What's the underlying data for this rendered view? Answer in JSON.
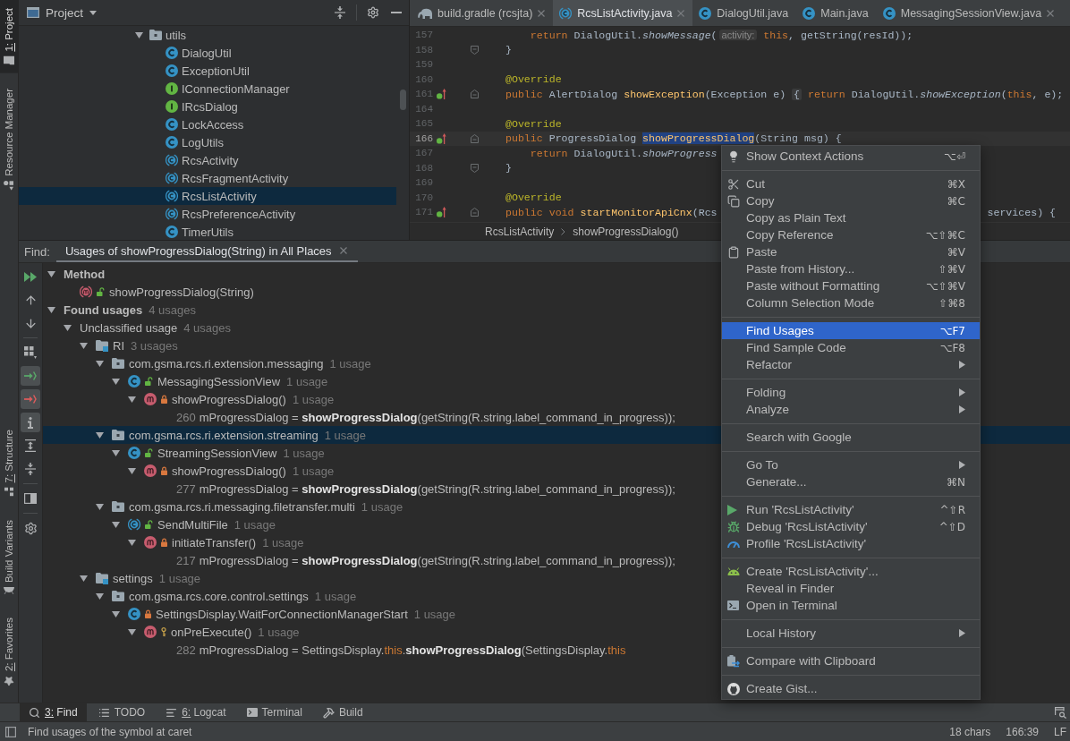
{
  "left_strip": {
    "top": [
      {
        "label": "1: Project",
        "kind": "project",
        "selected": true,
        "mnemonic": true
      },
      {
        "label": "Resource Manager",
        "kind": "resources",
        "selected": false,
        "mnemonic": false
      }
    ],
    "bottom": [
      {
        "label": "7: Structure",
        "kind": "structure",
        "selected": false,
        "mnemonic": true
      },
      {
        "label": "Build Variants",
        "kind": "variants",
        "selected": false,
        "mnemonic": false
      },
      {
        "label": "2: Favorites",
        "kind": "favorites",
        "selected": false,
        "mnemonic": true
      }
    ]
  },
  "project_panel": {
    "title": "Project",
    "tree": {
      "label": "utils",
      "kind": "package",
      "expanded": true,
      "selected": false,
      "children": [
        {
          "label": "DialogUtil",
          "kind": "class",
          "selected": false
        },
        {
          "label": "ExceptionUtil",
          "kind": "class",
          "selected": false
        },
        {
          "label": "IConnectionManager",
          "kind": "interface",
          "selected": false
        },
        {
          "label": "IRcsDialog",
          "kind": "interface",
          "selected": false
        },
        {
          "label": "LockAccess",
          "kind": "class",
          "selected": false
        },
        {
          "label": "LogUtils",
          "kind": "class",
          "selected": false
        },
        {
          "label": "RcsActivity",
          "kind": "abstract_class",
          "selected": false
        },
        {
          "label": "RcsFragmentActivity",
          "kind": "abstract_class",
          "selected": false
        },
        {
          "label": "RcsListActivity",
          "kind": "abstract_class",
          "selected": true
        },
        {
          "label": "RcsPreferenceActivity",
          "kind": "abstract_class",
          "selected": false
        },
        {
          "label": "TimerUtils",
          "kind": "class",
          "selected": false
        }
      ]
    }
  },
  "editor": {
    "tabs": [
      {
        "label": "build.gradle (rcsjta)",
        "kind": "gradle",
        "selected": false,
        "closable": true
      },
      {
        "label": "RcsListActivity.java",
        "kind": "abstract_class",
        "selected": true,
        "closable": true
      },
      {
        "label": "DialogUtil.java",
        "kind": "class",
        "selected": false,
        "closable": false
      },
      {
        "label": "Main.java",
        "kind": "class",
        "selected": false,
        "closable": false
      },
      {
        "label": "MessagingSessionView.java",
        "kind": "class",
        "selected": false,
        "closable": true
      }
    ],
    "lines": [
      {
        "number": "157",
        "current": false,
        "override": false,
        "fold_start": false,
        "fold_end": false,
        "indented": true,
        "tokens": [
          {
            "text": "return",
            "kind": "keyword"
          },
          {
            "text": " DialogUtil.",
            "kind": "plain"
          },
          {
            "text": "showMessage",
            "kind": "static_call"
          },
          {
            "text": "(",
            "kind": "plain"
          },
          {
            "text": "activity:",
            "kind": "hint"
          },
          {
            "text": " this",
            "kind": "keyword"
          },
          {
            "text": ", getString(resId));",
            "kind": "plain"
          }
        ]
      },
      {
        "number": "158",
        "current": false,
        "override": false,
        "fold_start": false,
        "fold_end": true,
        "indented": false,
        "tokens": [
          {
            "text": "}",
            "kind": "plain"
          }
        ]
      },
      {
        "number": "159",
        "current": false,
        "override": false,
        "fold_start": false,
        "fold_end": false
      },
      {
        "number": "160",
        "current": false,
        "override": false,
        "fold_start": false,
        "fold_end": false,
        "indented": false,
        "tokens": [
          {
            "text": "@Override",
            "kind": "annotation"
          }
        ]
      },
      {
        "number": "161",
        "current": false,
        "override": true,
        "fold_start": true,
        "fold_end": false,
        "indented": false,
        "tokens": [
          {
            "text": "public",
            "kind": "keyword"
          },
          {
            "text": " AlertDialog ",
            "kind": "plain"
          },
          {
            "text": "showException",
            "kind": "declaration"
          },
          {
            "text": "(Exception e) ",
            "kind": "plain"
          },
          {
            "text": "{",
            "kind": "fold_brace"
          },
          {
            "text": " return",
            "kind": "keyword"
          },
          {
            "text": " DialogUtil.",
            "kind": "plain"
          },
          {
            "text": "showException",
            "kind": "static_call"
          },
          {
            "text": "(",
            "kind": "plain"
          },
          {
            "text": "this",
            "kind": "keyword"
          },
          {
            "text": ", e);",
            "kind": "plain"
          }
        ]
      },
      {
        "number": "164",
        "current": false,
        "override": false,
        "fold_start": false,
        "fold_end": false
      },
      {
        "number": "165",
        "current": false,
        "override": false,
        "fold_start": false,
        "fold_end": false,
        "indented": false,
        "tokens": [
          {
            "text": "@Override",
            "kind": "annotation"
          }
        ]
      },
      {
        "number": "166",
        "current": true,
        "override": true,
        "fold_start": true,
        "fold_end": false,
        "indented": false,
        "tokens": [
          {
            "text": "public",
            "kind": "keyword"
          },
          {
            "text": " ProgressDialog ",
            "kind": "plain"
          },
          {
            "text": "showProgressDialog",
            "kind": "selection"
          },
          {
            "text": "(String msg) {",
            "kind": "plain"
          }
        ]
      },
      {
        "number": "167",
        "current": false,
        "override": false,
        "fold_start": false,
        "fold_end": false,
        "indented": true,
        "tokens": [
          {
            "text": "return",
            "kind": "keyword"
          },
          {
            "text": " DialogUtil.",
            "kind": "plain"
          },
          {
            "text": "showProgress",
            "kind": "static_call"
          }
        ]
      },
      {
        "number": "168",
        "current": false,
        "override": false,
        "fold_start": false,
        "fold_end": true,
        "indented": false,
        "tokens": [
          {
            "text": "}",
            "kind": "plain"
          }
        ]
      },
      {
        "number": "169",
        "current": false,
        "override": false,
        "fold_start": false,
        "fold_end": false
      },
      {
        "number": "170",
        "current": false,
        "override": false,
        "fold_start": false,
        "fold_end": false,
        "indented": false,
        "tokens": [
          {
            "text": "@Override",
            "kind": "annotation"
          }
        ]
      },
      {
        "number": "171",
        "current": false,
        "override": true,
        "fold_start": true,
        "fold_end": false,
        "indented": false,
        "tokens": [
          {
            "text": "public",
            "kind": "keyword"
          },
          {
            "text": " void",
            "kind": "keyword"
          },
          {
            "text": " startMonitorApiCnx",
            "kind": "declaration"
          },
          {
            "text": "(Rcs",
            "kind": "plain"
          },
          {
            "text": "services) {",
            "kind": "tail"
          }
        ]
      }
    ],
    "breadcrumbs": [
      "RcsListActivity",
      "showProgressDialog()"
    ]
  },
  "find_panel": {
    "label": "Find:",
    "tabs": [
      {
        "label": "Usages of showProgressDialog(String) in All Places",
        "selected": true,
        "closable": true
      }
    ],
    "toolbar": [
      {
        "buttons": [
          {
            "kind": "rerun",
            "on": false
          },
          {
            "kind": "previous",
            "on": false
          },
          {
            "kind": "next",
            "on": false
          }
        ]
      },
      {
        "buttons": [
          {
            "kind": "group",
            "on": false
          },
          {
            "kind": "read",
            "on": true
          },
          {
            "kind": "write",
            "on": true
          },
          {
            "kind": "imports",
            "on": true
          },
          {
            "kind": "expand",
            "on": false
          },
          {
            "kind": "collapse",
            "on": false
          }
        ]
      },
      {
        "buttons": [
          {
            "kind": "preview",
            "on": false
          }
        ]
      },
      {
        "buttons": [
          {
            "kind": "settings",
            "on": false
          }
        ]
      }
    ],
    "tree": [
      {
        "label": "Method",
        "kind": "heading",
        "expanded": true,
        "selected": false,
        "children": [
          {
            "label": "showProgressDialog(String)",
            "kind": "method_abstract",
            "modifier": {
              "kind": "public"
            },
            "selected": false
          }
        ]
      },
      {
        "label": "Found usages",
        "kind": "heading",
        "count": "4 usages",
        "expanded": true,
        "selected": false,
        "children": [
          {
            "label": "Unclassified usage",
            "kind": "category",
            "count": "4 usages",
            "expanded": true,
            "selected": false,
            "children": [
              {
                "label": "RI",
                "kind": "module",
                "count": "3 usages",
                "expanded": true,
                "selected": false,
                "children": [
                  {
                    "label": "com.gsma.rcs.ri.extension.messaging",
                    "kind": "package",
                    "count": "1 usage",
                    "expanded": true,
                    "selected": false,
                    "children": [
                      {
                        "label": "MessagingSessionView",
                        "kind": "class",
                        "modifier": {
                          "kind": "public"
                        },
                        "count": "1 usage",
                        "expanded": true,
                        "selected": false,
                        "children": [
                          {
                            "label": "showProgressDialog()",
                            "kind": "method",
                            "modifier": {
                              "kind": "private"
                            },
                            "count": "1 usage",
                            "expanded": true,
                            "selected": false,
                            "children": [
                              {
                                "kind": "usage",
                                "line": "260",
                                "selected": false,
                                "tokens": [
                                  {
                                    "text": "mProgressDialog = ",
                                    "kind": "plain"
                                  },
                                  {
                                    "text": "showProgressDialog",
                                    "kind": "match"
                                  },
                                  {
                                    "text": "(getString(R.string.label_command_in_progress));",
                                    "kind": "plain"
                                  }
                                ]
                              }
                            ]
                          }
                        ]
                      }
                    ]
                  },
                  {
                    "label": "com.gsma.rcs.ri.extension.streaming",
                    "kind": "package",
                    "count": "1 usage",
                    "expanded": true,
                    "selected": true,
                    "children": [
                      {
                        "label": "StreamingSessionView",
                        "kind": "class",
                        "modifier": {
                          "kind": "public"
                        },
                        "count": "1 usage",
                        "expanded": true,
                        "selected": false,
                        "children": [
                          {
                            "label": "showProgressDialog()",
                            "kind": "method",
                            "modifier": {
                              "kind": "private"
                            },
                            "count": "1 usage",
                            "expanded": true,
                            "selected": false,
                            "children": [
                              {
                                "kind": "usage",
                                "line": "277",
                                "selected": false,
                                "tokens": [
                                  {
                                    "text": "mProgressDialog = ",
                                    "kind": "plain"
                                  },
                                  {
                                    "text": "showProgressDialog",
                                    "kind": "match"
                                  },
                                  {
                                    "text": "(getString(R.string.label_command_in_progress));",
                                    "kind": "plain"
                                  }
                                ]
                              }
                            ]
                          }
                        ]
                      }
                    ]
                  },
                  {
                    "label": "com.gsma.rcs.ri.messaging.filetransfer.multi",
                    "kind": "package",
                    "count": "1 usage",
                    "expanded": true,
                    "selected": false,
                    "children": [
                      {
                        "label": "SendMultiFile",
                        "kind": "abstract_class",
                        "modifier": {
                          "kind": "public"
                        },
                        "count": "1 usage",
                        "expanded": true,
                        "selected": false,
                        "children": [
                          {
                            "label": "initiateTransfer()",
                            "kind": "method",
                            "modifier": {
                              "kind": "private"
                            },
                            "count": "1 usage",
                            "expanded": true,
                            "selected": false,
                            "children": [
                              {
                                "kind": "usage",
                                "line": "217",
                                "selected": false,
                                "tokens": [
                                  {
                                    "text": "mProgressDialog = ",
                                    "kind": "plain"
                                  },
                                  {
                                    "text": "showProgressDialog",
                                    "kind": "match"
                                  },
                                  {
                                    "text": "(getString(R.string.label_command_in_progress));",
                                    "kind": "plain"
                                  }
                                ]
                              }
                            ]
                          }
                        ]
                      }
                    ]
                  }
                ]
              },
              {
                "label": "settings",
                "kind": "module",
                "count": "1 usage",
                "expanded": true,
                "selected": false,
                "children": [
                  {
                    "label": "com.gsma.rcs.core.control.settings",
                    "kind": "package",
                    "count": "1 usage",
                    "expanded": true,
                    "selected": false,
                    "children": [
                      {
                        "label": "SettingsDisplay.WaitForConnectionManagerStart",
                        "kind": "class",
                        "modifier": {
                          "kind": "private"
                        },
                        "count": "1 usage",
                        "expanded": true,
                        "selected": false,
                        "children": [
                          {
                            "label": "onPreExecute()",
                            "kind": "method",
                            "modifier": {
                              "kind": "protected"
                            },
                            "count": "1 usage",
                            "expanded": true,
                            "selected": false,
                            "children": [
                              {
                                "kind": "usage",
                                "line": "282",
                                "selected": false,
                                "tokens": [
                                  {
                                    "text": "mProgressDialog = SettingsDisplay.",
                                    "kind": "plain"
                                  },
                                  {
                                    "text": "this",
                                    "kind": "keyword"
                                  },
                                  {
                                    "text": ".",
                                    "kind": "plain"
                                  },
                                  {
                                    "text": "showProgressDialog",
                                    "kind": "match"
                                  },
                                  {
                                    "text": "(SettingsDisplay.",
                                    "kind": "plain"
                                  },
                                  {
                                    "text": "this",
                                    "kind": "keyword"
                                  }
                                ]
                              }
                            ]
                          }
                        ]
                      }
                    ]
                  }
                ]
              }
            ]
          }
        ]
      }
    ]
  },
  "context_menu": {
    "groups": [
      {
        "items": [
          {
            "label": "Show Context Actions",
            "shortcut": "⌥⏎",
            "kind": "bulb",
            "selected": false,
            "submenu": false
          }
        ]
      },
      {
        "items": [
          {
            "label": "Cut",
            "shortcut": "⌘X",
            "kind": "cut",
            "selected": false,
            "submenu": false
          },
          {
            "label": "Copy",
            "shortcut": "⌘C",
            "kind": "copy",
            "selected": false,
            "submenu": false
          },
          {
            "label": "Copy as Plain Text",
            "kind": "plain",
            "selected": false,
            "submenu": false
          },
          {
            "label": "Copy Reference",
            "shortcut": "⌥⇧⌘C",
            "kind": "plain",
            "selected": false,
            "submenu": false
          },
          {
            "label": "Paste",
            "shortcut": "⌘V",
            "kind": "paste",
            "selected": false,
            "submenu": false
          },
          {
            "label": "Paste from History...",
            "shortcut": "⇧⌘V",
            "kind": "plain",
            "selected": false,
            "submenu": false
          },
          {
            "label": "Paste without Formatting",
            "shortcut": "⌥⇧⌘V",
            "kind": "plain",
            "selected": false,
            "submenu": false
          },
          {
            "label": "Column Selection Mode",
            "shortcut": "⇧⌘8",
            "kind": "plain",
            "selected": false,
            "submenu": false
          }
        ]
      },
      {
        "items": [
          {
            "label": "Find Usages",
            "shortcut": "⌥F7",
            "kind": "plain",
            "selected": true,
            "submenu": false
          },
          {
            "label": "Find Sample Code",
            "shortcut": "⌥F8",
            "kind": "plain",
            "selected": false,
            "submenu": false
          },
          {
            "label": "Refactor",
            "kind": "plain",
            "selected": false,
            "submenu": true
          }
        ]
      },
      {
        "items": [
          {
            "label": "Folding",
            "kind": "plain",
            "selected": false,
            "submenu": true
          },
          {
            "label": "Analyze",
            "kind": "plain",
            "selected": false,
            "submenu": true
          }
        ]
      },
      {
        "items": [
          {
            "label": "Search with Google",
            "kind": "plain",
            "selected": false,
            "submenu": false
          }
        ]
      },
      {
        "items": [
          {
            "label": "Go To",
            "kind": "plain",
            "selected": false,
            "submenu": true
          },
          {
            "label": "Generate...",
            "shortcut": "⌘N",
            "kind": "plain",
            "selected": false,
            "submenu": false
          }
        ]
      },
      {
        "items": [
          {
            "label": "Run 'RcsListActivity'",
            "shortcut": "^⇧R",
            "kind": "run",
            "selected": false,
            "submenu": false
          },
          {
            "label": "Debug 'RcsListActivity'",
            "shortcut": "^⇧D",
            "kind": "debug",
            "selected": false,
            "submenu": false
          },
          {
            "label": "Profile 'RcsListActivity'",
            "kind": "profile",
            "selected": false,
            "submenu": false
          }
        ]
      },
      {
        "items": [
          {
            "label": "Create 'RcsListActivity'...",
            "kind": "android",
            "selected": false,
            "submenu": false
          },
          {
            "label": "Reveal in Finder",
            "kind": "plain",
            "selected": false,
            "submenu": false
          },
          {
            "label": "Open in Terminal",
            "kind": "terminal",
            "selected": false,
            "submenu": false
          }
        ]
      },
      {
        "items": [
          {
            "label": "Local History",
            "kind": "plain",
            "selected": false,
            "submenu": true
          }
        ]
      },
      {
        "items": [
          {
            "label": "Compare with Clipboard",
            "kind": "compare",
            "selected": false,
            "submenu": false
          }
        ]
      },
      {
        "items": [
          {
            "label": "Create Gist...",
            "kind": "gist",
            "selected": false,
            "submenu": false
          }
        ]
      }
    ]
  },
  "tool_tabs": [
    {
      "label": "3: Find",
      "kind": "find",
      "selected": true,
      "mnemonic": true
    },
    {
      "label": "TODO",
      "kind": "todo",
      "selected": false,
      "mnemonic": false
    },
    {
      "label": "6: Logcat",
      "kind": "logcat",
      "selected": false,
      "mnemonic": true
    },
    {
      "label": "Terminal",
      "kind": "terminal",
      "selected": false,
      "mnemonic": false
    },
    {
      "label": "Build",
      "kind": "build",
      "selected": false,
      "mnemonic": false
    }
  ],
  "status_bar": {
    "message": "Find usages of the symbol at caret",
    "items": [
      "18 chars",
      "166:39",
      "LF"
    ]
  }
}
